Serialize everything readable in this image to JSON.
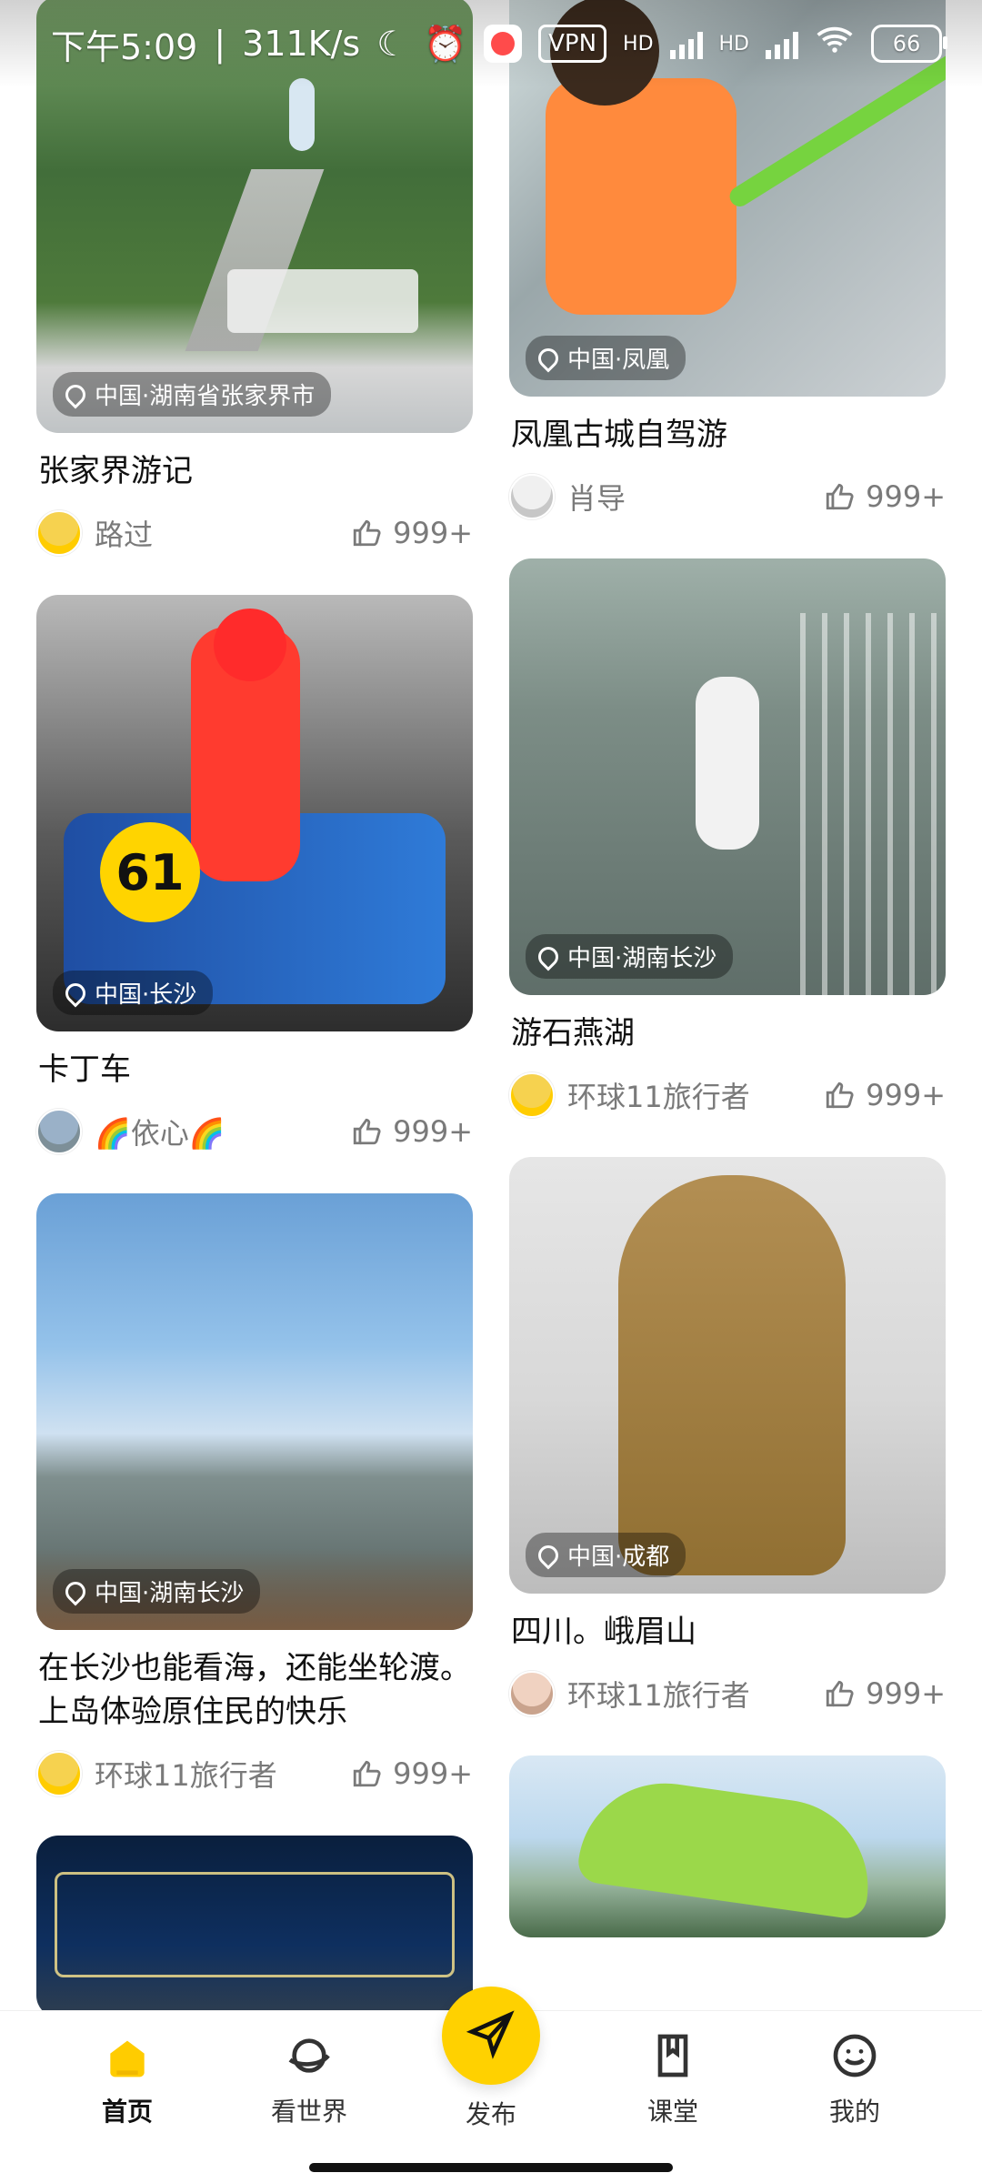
{
  "status_bar": {
    "time": "下午5:09",
    "speed": "311K/s",
    "vpn_label": "VPN",
    "hd1": "HD",
    "hd2": "HD",
    "battery": "66"
  },
  "feed": {
    "left": [
      {
        "title": "张家界游记",
        "location": "中国·湖南省张家界市",
        "author": "路过",
        "likes": "999+"
      },
      {
        "title": "卡丁车",
        "location": "中国·长沙",
        "author": "🌈依心🌈",
        "likes": "999+"
      },
      {
        "title": "在长沙也能看海，还能坐轮渡。上岛体验原住民的快乐",
        "location": "中国·湖南长沙",
        "author": "环球11旅行者",
        "likes": "999+"
      }
    ],
    "right": [
      {
        "title": "凤凰古城自驾游",
        "location": "中国·凤凰",
        "author": "肖导",
        "likes": "999+"
      },
      {
        "title": "游石燕湖",
        "location": "中国·湖南长沙",
        "author": "环球11旅行者",
        "likes": "999+"
      },
      {
        "title": "四川。峨眉山",
        "location": "中国·成都",
        "author": "环球11旅行者",
        "likes": "999+"
      }
    ]
  },
  "bottom_nav": {
    "items": [
      {
        "label": "首页",
        "icon": "home-icon",
        "active": true
      },
      {
        "label": "看世界",
        "icon": "planet-icon",
        "active": false
      },
      {
        "label": "发布",
        "icon": "paper-plane-icon",
        "active": false
      },
      {
        "label": "课堂",
        "icon": "book-icon",
        "active": false
      },
      {
        "label": "我的",
        "icon": "smile-icon",
        "active": false
      }
    ],
    "accent": "#ffd100"
  }
}
